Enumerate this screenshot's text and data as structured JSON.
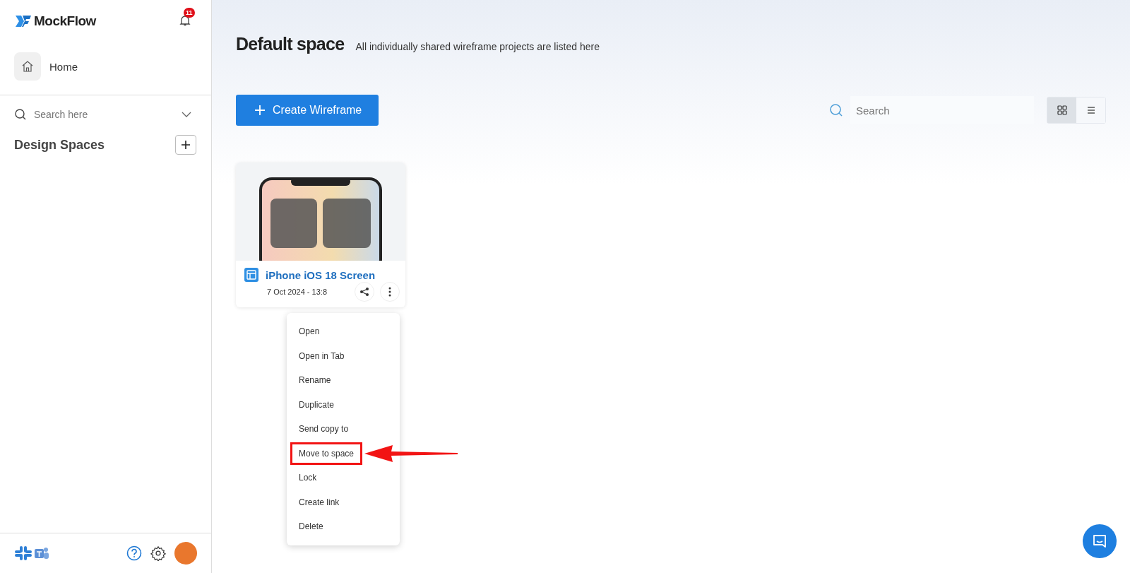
{
  "sidebar": {
    "brand": "MockFlow",
    "notifications": {
      "count": "11"
    },
    "home": {
      "label": "Home"
    },
    "search": {
      "placeholder": "Search here"
    },
    "section": {
      "title": "Design Spaces"
    }
  },
  "header": {
    "title": "Default space",
    "subtitle": "All individually shared wireframe projects are listed here"
  },
  "toolbar": {
    "create_button": "Create Wireframe",
    "search": {
      "placeholder": "Search"
    },
    "views": [
      {
        "kind": "grid",
        "selected": true
      },
      {
        "kind": "list",
        "selected": false
      }
    ]
  },
  "projects": [
    {
      "title": "iPhone iOS 18 Screen",
      "date": "7 Oct 2024 - 13:8"
    }
  ],
  "context_menu": {
    "items": [
      {
        "label": "Open",
        "highlighted": false
      },
      {
        "label": "Open in Tab",
        "highlighted": false
      },
      {
        "label": "Rename",
        "highlighted": false
      },
      {
        "label": "Duplicate",
        "highlighted": false
      },
      {
        "label": "Send copy to",
        "highlighted": false
      },
      {
        "label": "Move to space",
        "highlighted": true
      },
      {
        "label": "Lock",
        "highlighted": false
      },
      {
        "label": "Create link",
        "highlighted": false
      },
      {
        "label": "Delete",
        "highlighted": false
      }
    ]
  }
}
